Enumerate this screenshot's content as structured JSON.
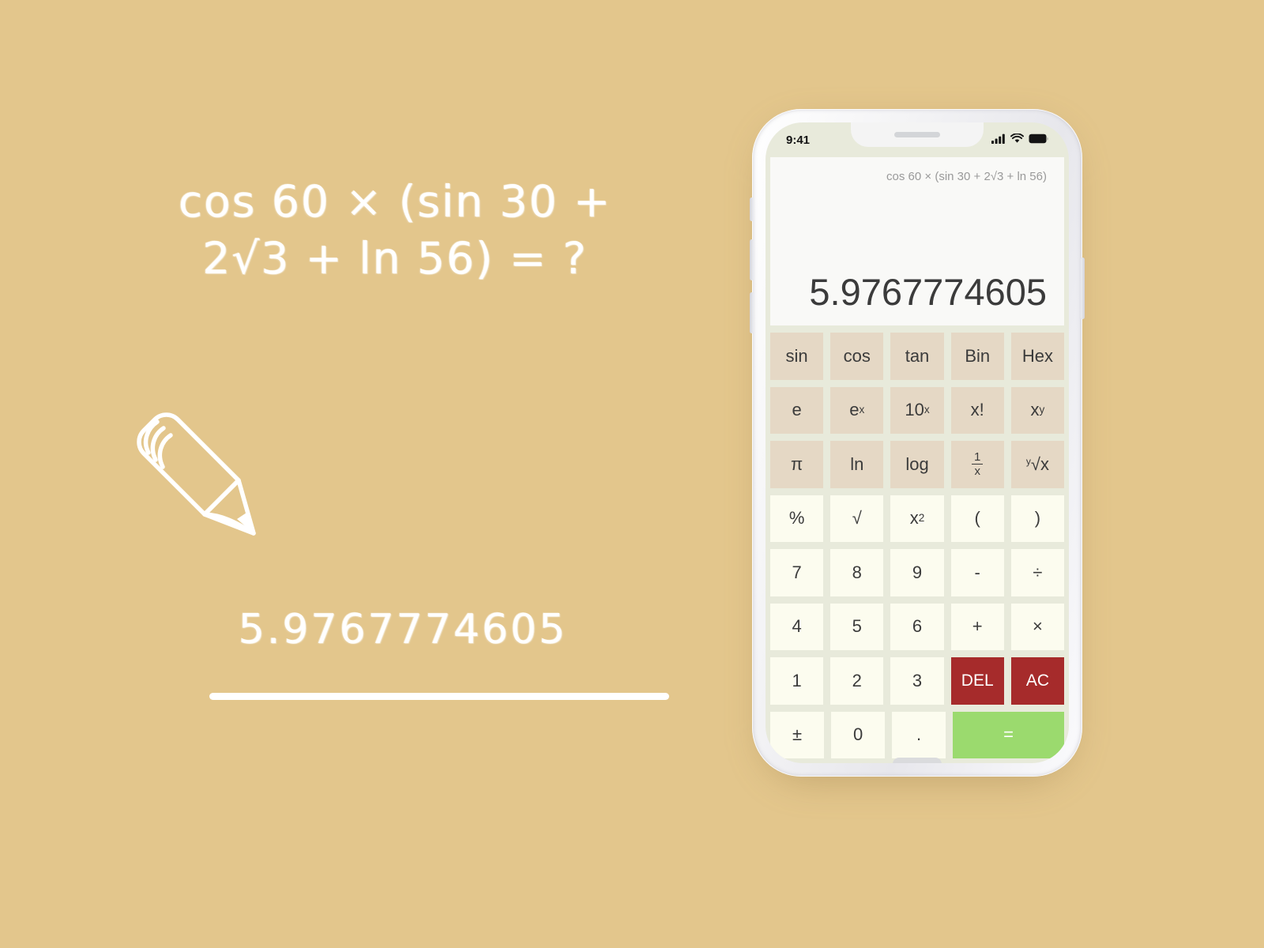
{
  "background_color": "#e3c68c",
  "chalk": {
    "equation_line1": "cos 60 × (sin 30 +",
    "equation_line2": "2√3 + ln 56) = ?",
    "answer": "5.9767774605",
    "pencil_icon": "pencil-icon"
  },
  "phone": {
    "status_bar": {
      "time": "9:41",
      "signal_icon": "cellular-signal-icon",
      "wifi_icon": "wifi-icon",
      "battery_icon": "battery-icon"
    },
    "side_buttons": [
      "mute-switch",
      "volume-up",
      "volume-down",
      "power-button"
    ]
  },
  "calculator": {
    "display": {
      "expression": "cos 60 × (sin 30 + 2√3 + ln 56)",
      "result": "5.9767774605"
    },
    "colors": {
      "function_key": "#e5d8c5",
      "number_key": "#fcfcef",
      "danger_key": "#a62b2b",
      "equals_key": "#9bda6e",
      "keypad_background": "#e8eadb",
      "display_background": "#f9f9f7"
    },
    "rows": [
      [
        {
          "name": "sin",
          "label": "sin",
          "style": "fn"
        },
        {
          "name": "cos",
          "label": "cos",
          "style": "fn"
        },
        {
          "name": "tan",
          "label": "tan",
          "style": "fn"
        },
        {
          "name": "bin",
          "label": "Bin",
          "style": "fn"
        },
        {
          "name": "hex",
          "label": "Hex",
          "style": "fn"
        }
      ],
      [
        {
          "name": "e",
          "label": "e",
          "style": "fn"
        },
        {
          "name": "e-power-x",
          "label": "e^x",
          "base": "e",
          "sup": "x",
          "style": "fn"
        },
        {
          "name": "ten-power-x",
          "label": "10^x",
          "base": "10",
          "sup": "x",
          "style": "fn"
        },
        {
          "name": "factorial",
          "label": "x!",
          "style": "fn"
        },
        {
          "name": "x-power-y",
          "label": "x^y",
          "base": "x",
          "sup": "y",
          "style": "fn"
        }
      ],
      [
        {
          "name": "pi",
          "label": "π",
          "style": "fn"
        },
        {
          "name": "ln",
          "label": "ln",
          "style": "fn"
        },
        {
          "name": "log",
          "label": "log",
          "style": "fn"
        },
        {
          "name": "reciprocal",
          "label": "1/x",
          "numerator": "1",
          "denominator": "x",
          "style": "fn"
        },
        {
          "name": "nth-root",
          "label": "y√x",
          "index": "y",
          "radicand": "√x",
          "style": "fn"
        }
      ],
      [
        {
          "name": "percent",
          "label": "%",
          "style": "num"
        },
        {
          "name": "square-root",
          "label": "√",
          "style": "num"
        },
        {
          "name": "x-squared",
          "label": "x²",
          "base": "x",
          "sup": "2",
          "style": "num"
        },
        {
          "name": "open-paren",
          "label": "(",
          "style": "num"
        },
        {
          "name": "close-paren",
          "label": ")",
          "style": "num"
        }
      ],
      [
        {
          "name": "digit-7",
          "label": "7",
          "style": "num"
        },
        {
          "name": "digit-8",
          "label": "8",
          "style": "num"
        },
        {
          "name": "digit-9",
          "label": "9",
          "style": "num"
        },
        {
          "name": "minus",
          "label": "-",
          "style": "num"
        },
        {
          "name": "divide",
          "label": "÷",
          "style": "num"
        }
      ],
      [
        {
          "name": "digit-4",
          "label": "4",
          "style": "num"
        },
        {
          "name": "digit-5",
          "label": "5",
          "style": "num"
        },
        {
          "name": "digit-6",
          "label": "6",
          "style": "num"
        },
        {
          "name": "plus",
          "label": "+",
          "style": "num"
        },
        {
          "name": "multiply",
          "label": "×",
          "style": "num"
        }
      ],
      [
        {
          "name": "digit-1",
          "label": "1",
          "style": "num"
        },
        {
          "name": "digit-2",
          "label": "2",
          "style": "num"
        },
        {
          "name": "digit-3",
          "label": "3",
          "style": "num"
        },
        {
          "name": "delete",
          "label": "DEL",
          "style": "danger"
        },
        {
          "name": "all-clear",
          "label": "AC",
          "style": "danger"
        }
      ],
      [
        {
          "name": "plus-minus",
          "label": "±",
          "style": "num"
        },
        {
          "name": "digit-0",
          "label": "0",
          "style": "num"
        },
        {
          "name": "decimal-point",
          "label": ".",
          "style": "num"
        },
        {
          "name": "equals",
          "label": "=",
          "style": "equals"
        }
      ]
    ]
  }
}
